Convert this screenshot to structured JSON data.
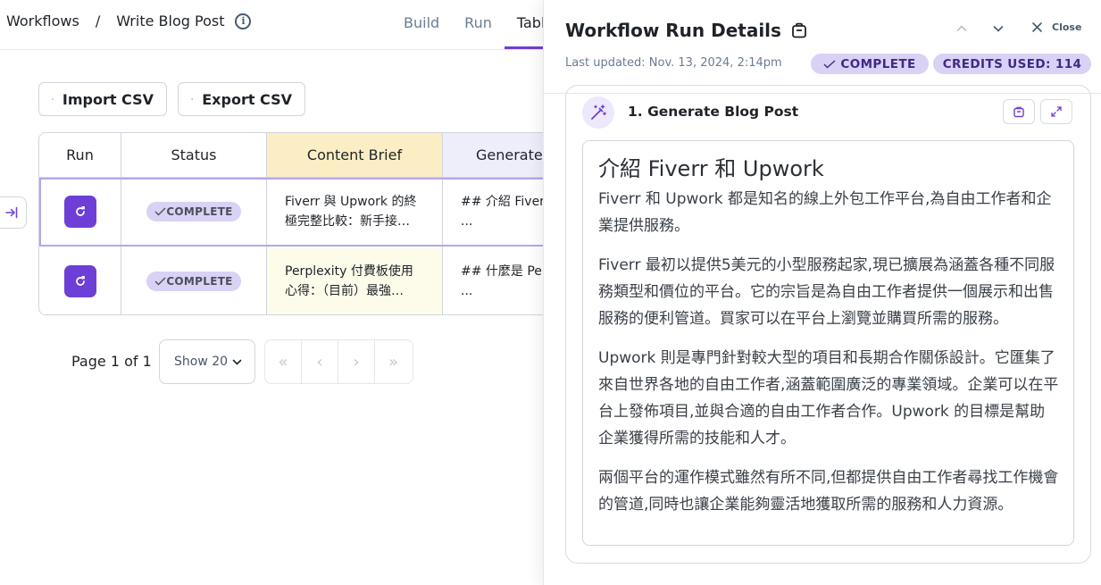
{
  "header": {
    "breadcrumbs": [
      "Workflows",
      "Write Blog Post"
    ],
    "separator": "/",
    "info_icon": "i",
    "tabs": [
      "Build",
      "Run",
      "Table"
    ]
  },
  "toolbar": {
    "import_label": "Import CSV",
    "export_label": "Export CSV"
  },
  "table": {
    "columns": [
      "Run",
      "Status",
      "Content Brief",
      "Generate"
    ],
    "rows": [
      {
        "status": "COMPLETE",
        "brief_line1": "Fiverr 與 Upwork 的終",
        "brief_line2": "極完整比較：新手接…",
        "generate_line1": "## 介紹 Fiver",
        "generate_line2": "..."
      },
      {
        "status": "COMPLETE",
        "brief_line1": "Perplexity 付費板使用",
        "brief_line2": "心得：（目前）最強…",
        "generate_line1": "## 什麼是 Per",
        "generate_line2": "..."
      }
    ]
  },
  "pagination": {
    "page_label": "Page 1 of 1",
    "show_label": "Show 20",
    "first": "«",
    "prev": "‹",
    "next": "›",
    "last": "»"
  },
  "panel": {
    "title": "Workflow Run Details",
    "close_label": "Close",
    "last_updated": "Last updated: Nov. 13, 2024, 2:14pm",
    "status_badge": "COMPLETE",
    "credits_badge": "CREDITS USED: 114",
    "step": {
      "title": "1. Generate Blog Post",
      "content_heading": "介紹 Fiverr 和 Upwork",
      "paragraphs": [
        "Fiverr 和 Upwork 都是知名的線上外包工作平台,為自由工作者和企業提供服務。",
        "Fiverr 最初以提供5美元的小型服務起家,現已擴展為涵蓋各種不同服務類型和價位的平台。它的宗旨是為自由工作者提供一個展示和出售服務的便利管道。買家可以在平台上瀏覽並購買所需的服務。",
        "Upwork 則是專門針對較大型的項目和長期合作關係設計。它匯集了來自世界各地的自由工作者,涵蓋範圍廣泛的專業領域。企業可以在平台上發佈項目,並與合適的自由工作者合作。Upwork 的目標是幫助企業獲得所需的技能和人才。",
        "兩個平台的運作模式雖然有所不同,但都提供自由工作者尋找工作機會的管道,同時也讓企業能夠靈活地獲取所需的服務和人力資源。"
      ]
    }
  },
  "colors": {
    "accent": "#6d3fd6",
    "badge_bg": "#d9d2f4",
    "brief_header_bg": "#fbeec4",
    "brief_cell_bg": "#fdfbea",
    "generate_header_bg": "#eeeefb"
  }
}
